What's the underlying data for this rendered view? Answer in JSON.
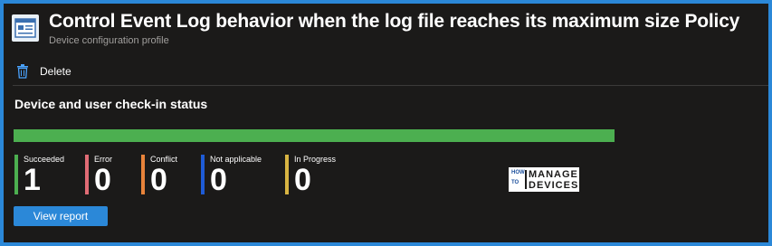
{
  "header": {
    "title": "Control Event Log behavior when the log file reaches its maximum size Policy",
    "subtitle": "Device configuration profile",
    "icon": "policy-document-icon"
  },
  "toolbar": {
    "delete_label": "Delete",
    "delete_icon": "trash-icon"
  },
  "status": {
    "section_title": "Device and user check-in status",
    "progress_fraction_succeeded": 1.0,
    "progress_color": "#4caf50",
    "stats": [
      {
        "label": "Succeeded",
        "value": "1",
        "color": "#4caf50"
      },
      {
        "label": "Error",
        "value": "0",
        "color": "#e06c75"
      },
      {
        "label": "Conflict",
        "value": "0",
        "color": "#e8833a"
      },
      {
        "label": "Not applicable",
        "value": "0",
        "color": "#1e5bd6"
      },
      {
        "label": "In Progress",
        "value": "0",
        "color": "#d8b442"
      }
    ],
    "view_report_label": "View report"
  },
  "watermark": {
    "how": "HOW",
    "to": "TO",
    "manage": "MANAGE",
    "devices": "DEVICES"
  },
  "colors": {
    "accent": "#2b88d8",
    "background": "#1b1a19"
  }
}
